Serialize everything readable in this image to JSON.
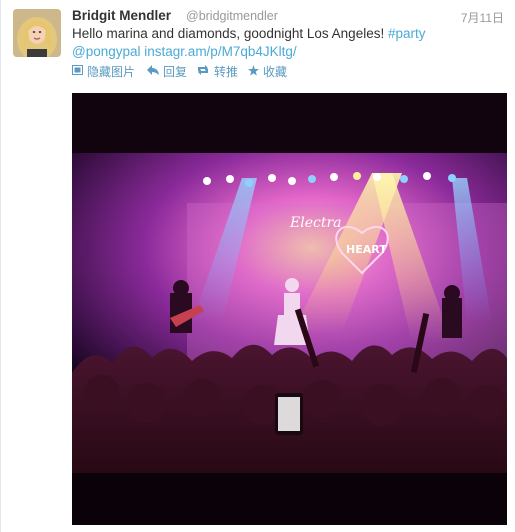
{
  "tweet": {
    "avatar_icon": "user-avatar-photo",
    "fullname": "Bridgit Mendler",
    "username": "@bridgitmendler",
    "date": "7月11日",
    "text_line1_prefix": "Hello marina and diamonds, goodnight Los Angeles! ",
    "hashtag": "#party",
    "mention": "@pongypal",
    "link": "instagr.am/p/M7qb4JKltg/",
    "colors": {
      "link": "#4aaad6",
      "action": "#5a9bbf",
      "name": "#333333",
      "meta": "#999999"
    },
    "actions": [
      {
        "label": "隐藏图片",
        "icon": "image-icon"
      },
      {
        "label": "回复",
        "icon": "reply-icon"
      },
      {
        "label": "转推",
        "icon": "retweet-icon"
      },
      {
        "label": "收藏",
        "icon": "star-icon"
      }
    ],
    "photo": {
      "banner_text": "Electra",
      "sign_text": "HEART"
    }
  }
}
